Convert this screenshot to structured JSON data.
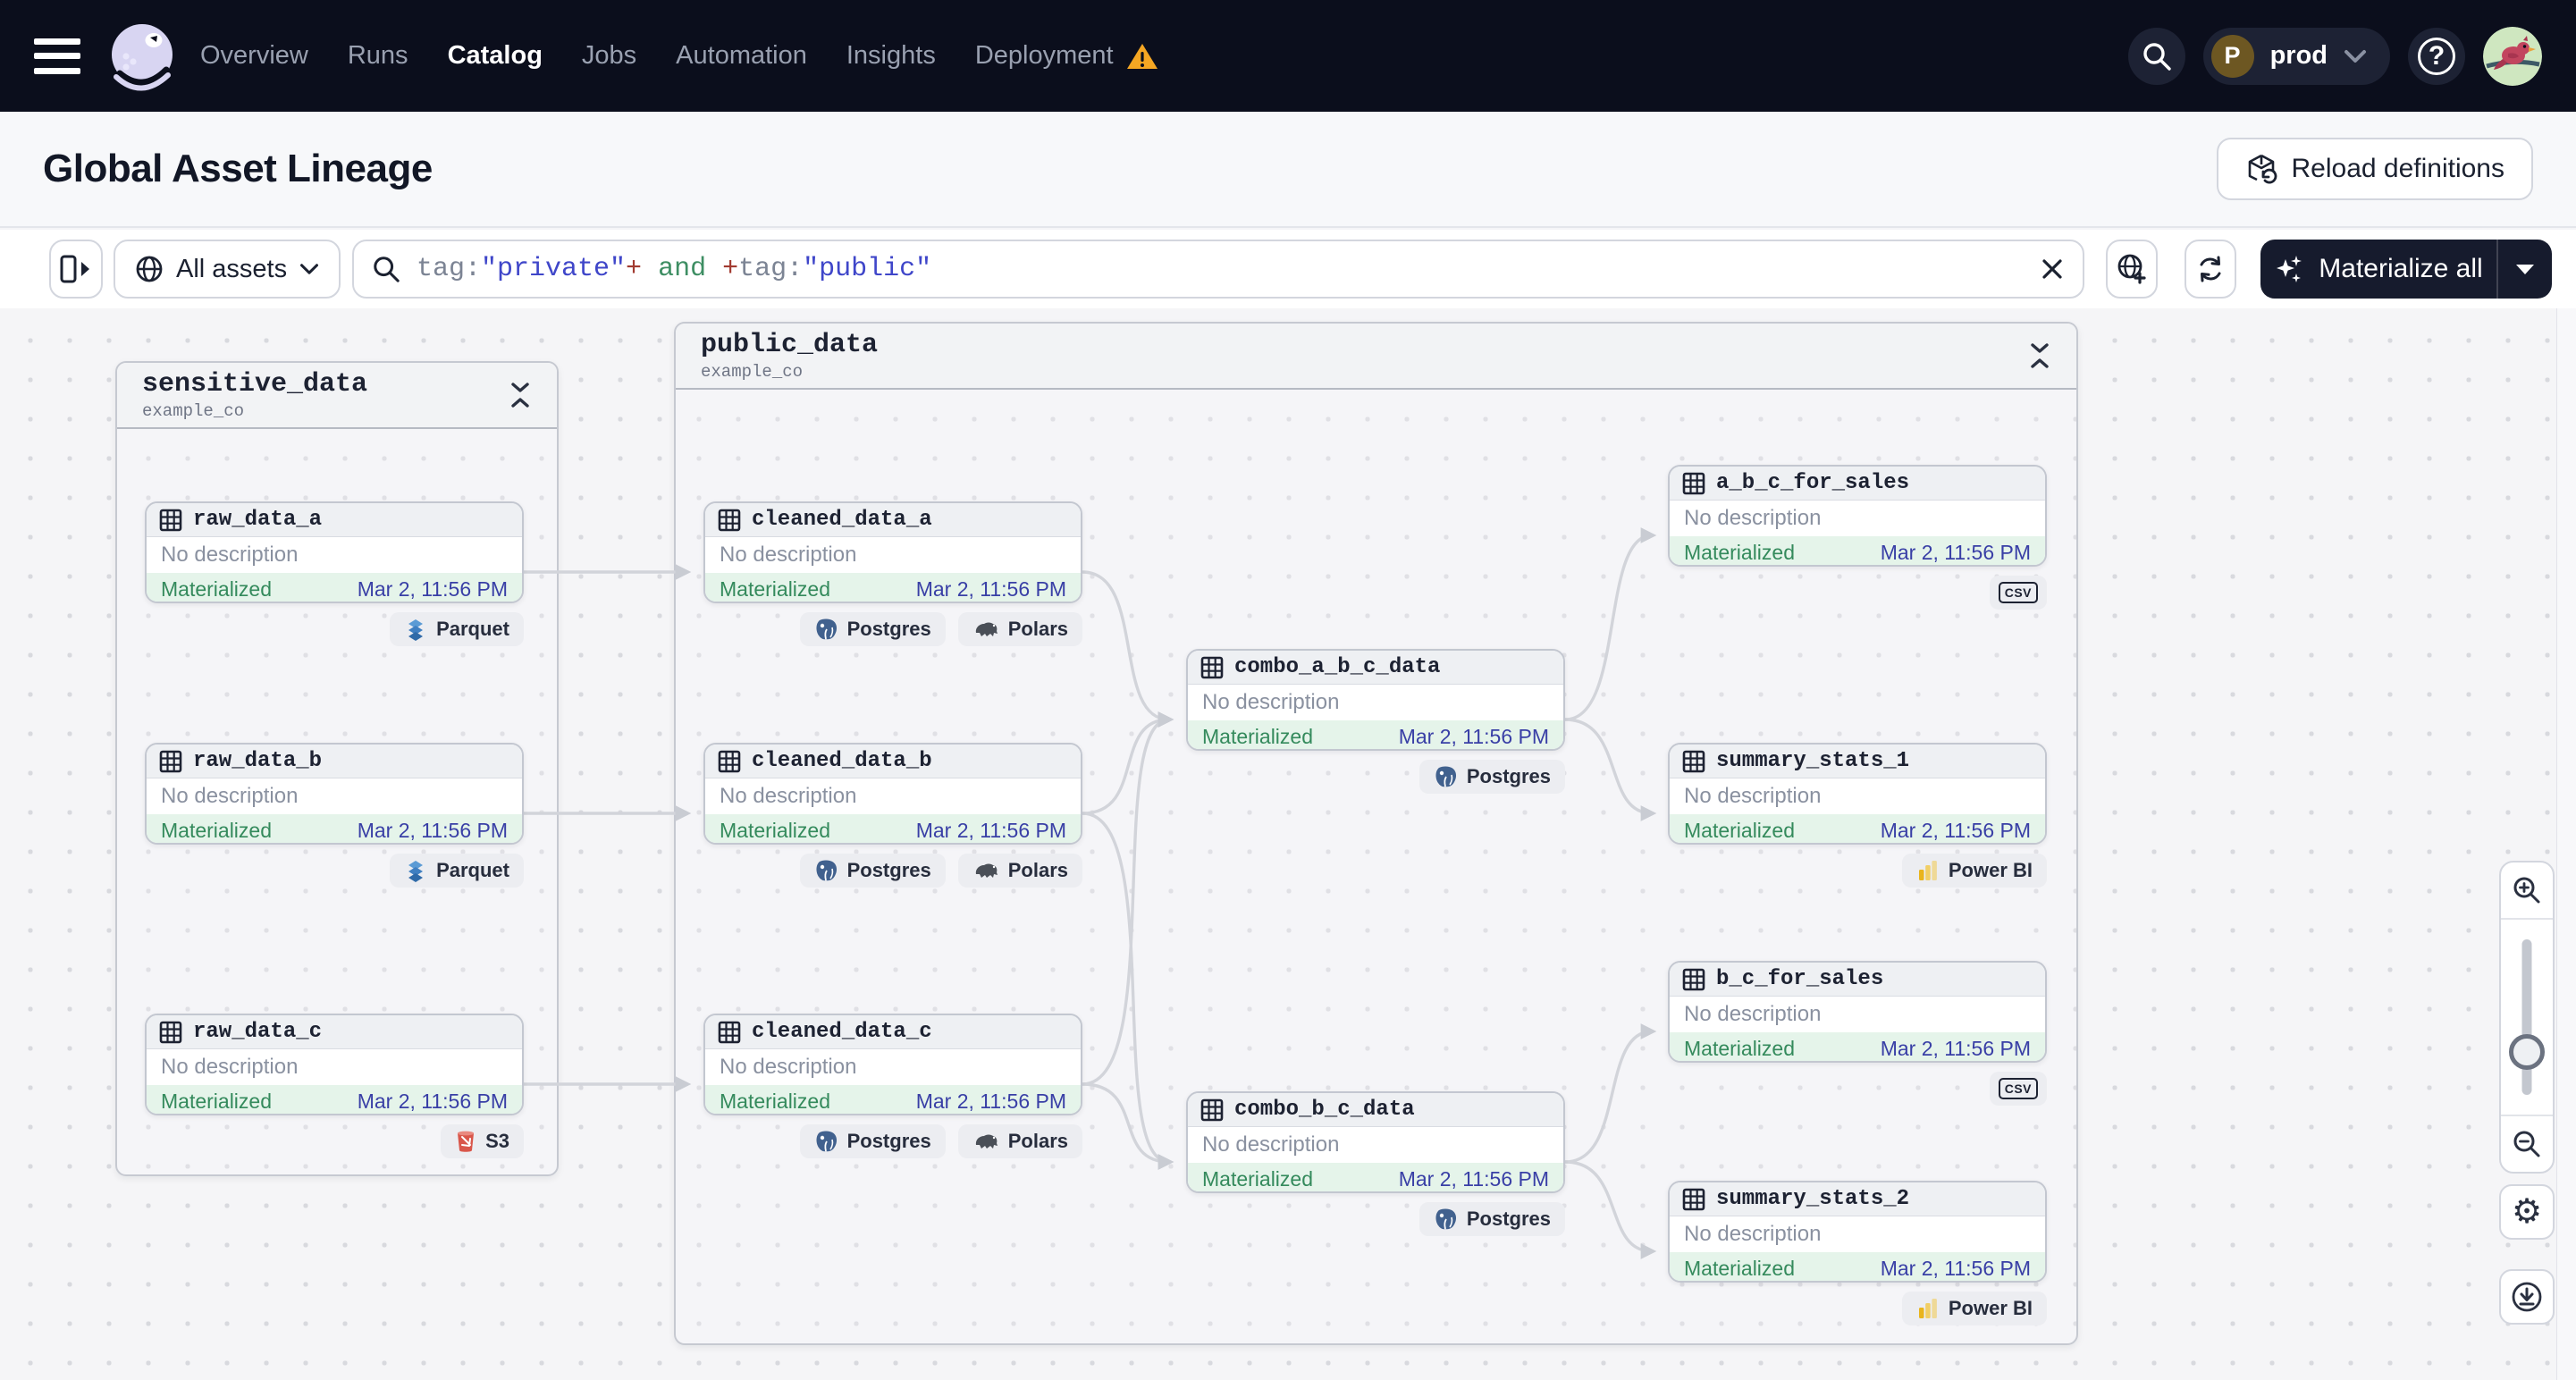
{
  "nav": {
    "links": [
      {
        "label": "Overview"
      },
      {
        "label": "Runs"
      },
      {
        "label": "Catalog"
      },
      {
        "label": "Jobs"
      },
      {
        "label": "Automation"
      },
      {
        "label": "Insights"
      },
      {
        "label": "Deployment"
      }
    ],
    "active_link": "Catalog",
    "environment": {
      "initial": "P",
      "name": "prod"
    }
  },
  "page": {
    "title": "Global Asset Lineage",
    "reload_button_label": "Reload definitions"
  },
  "toolbar": {
    "scope_label": "All assets",
    "materialize_label": "Materialize all",
    "query_segments": [
      {
        "text": "tag:",
        "kind": "key"
      },
      {
        "text": "\"private\"",
        "kind": "string"
      },
      {
        "text": "+",
        "kind": "operator"
      },
      {
        "text": " and ",
        "kind": "boolean"
      },
      {
        "text": "+",
        "kind": "operator"
      },
      {
        "text": "tag:",
        "kind": "key"
      },
      {
        "text": "\"public\"",
        "kind": "string"
      }
    ]
  },
  "colors": {
    "nav_bg": "#0b0e1c",
    "materialized_green": "#348a5c",
    "timestamp_indigo": "#393fa6",
    "warning_orange": "#f5a623",
    "query_string": "#3f46c9",
    "query_operator": "#a13a30",
    "query_boolean": "#3e8e63"
  },
  "graph": {
    "groups": [
      {
        "title": "sensitive_data",
        "subtitle": "example_co",
        "nodes": [
          {
            "name": "raw_data_a",
            "description": "No description",
            "status": "Materialized",
            "timestamp": "Mar 2, 11:56 PM",
            "kinds": [
              "Parquet"
            ]
          },
          {
            "name": "raw_data_b",
            "description": "No description",
            "status": "Materialized",
            "timestamp": "Mar 2, 11:56 PM",
            "kinds": [
              "Parquet"
            ]
          },
          {
            "name": "raw_data_c",
            "description": "No description",
            "status": "Materialized",
            "timestamp": "Mar 2, 11:56 PM",
            "kinds": [
              "S3"
            ]
          }
        ]
      },
      {
        "title": "public_data",
        "subtitle": "example_co",
        "nodes": [
          {
            "name": "cleaned_data_a",
            "description": "No description",
            "status": "Materialized",
            "timestamp": "Mar 2, 11:56 PM",
            "kinds": [
              "Postgres",
              "Polars"
            ]
          },
          {
            "name": "cleaned_data_b",
            "description": "No description",
            "status": "Materialized",
            "timestamp": "Mar 2, 11:56 PM",
            "kinds": [
              "Postgres",
              "Polars"
            ]
          },
          {
            "name": "cleaned_data_c",
            "description": "No description",
            "status": "Materialized",
            "timestamp": "Mar 2, 11:56 PM",
            "kinds": [
              "Postgres",
              "Polars"
            ]
          },
          {
            "name": "combo_a_b_c_data",
            "description": "No description",
            "status": "Materialized",
            "timestamp": "Mar 2, 11:56 PM",
            "kinds": [
              "Postgres"
            ]
          },
          {
            "name": "combo_b_c_data",
            "description": "No description",
            "status": "Materialized",
            "timestamp": "Mar 2, 11:56 PM",
            "kinds": [
              "Postgres"
            ]
          },
          {
            "name": "a_b_c_for_sales",
            "description": "No description",
            "status": "Materialized",
            "timestamp": "Mar 2, 11:56 PM",
            "kinds": [
              "CSV"
            ]
          },
          {
            "name": "summary_stats_1",
            "description": "No description",
            "status": "Materialized",
            "timestamp": "Mar 2, 11:56 PM",
            "kinds": [
              "Power BI"
            ]
          },
          {
            "name": "b_c_for_sales",
            "description": "No description",
            "status": "Materialized",
            "timestamp": "Mar 2, 11:56 PM",
            "kinds": [
              "CSV"
            ]
          },
          {
            "name": "summary_stats_2",
            "description": "No description",
            "status": "Materialized",
            "timestamp": "Mar 2, 11:56 PM",
            "kinds": [
              "Power BI"
            ]
          }
        ]
      }
    ],
    "edges": [
      {
        "from": "raw_data_a",
        "to": "cleaned_data_a"
      },
      {
        "from": "raw_data_b",
        "to": "cleaned_data_b"
      },
      {
        "from": "raw_data_c",
        "to": "cleaned_data_c"
      },
      {
        "from": "cleaned_data_a",
        "to": "combo_a_b_c_data"
      },
      {
        "from": "cleaned_data_b",
        "to": "combo_a_b_c_data"
      },
      {
        "from": "cleaned_data_c",
        "to": "combo_a_b_c_data"
      },
      {
        "from": "cleaned_data_b",
        "to": "combo_b_c_data"
      },
      {
        "from": "cleaned_data_c",
        "to": "combo_b_c_data"
      },
      {
        "from": "combo_a_b_c_data",
        "to": "a_b_c_for_sales"
      },
      {
        "from": "combo_a_b_c_data",
        "to": "summary_stats_1"
      },
      {
        "from": "combo_b_c_data",
        "to": "b_c_for_sales"
      },
      {
        "from": "combo_b_c_data",
        "to": "summary_stats_2"
      }
    ]
  }
}
